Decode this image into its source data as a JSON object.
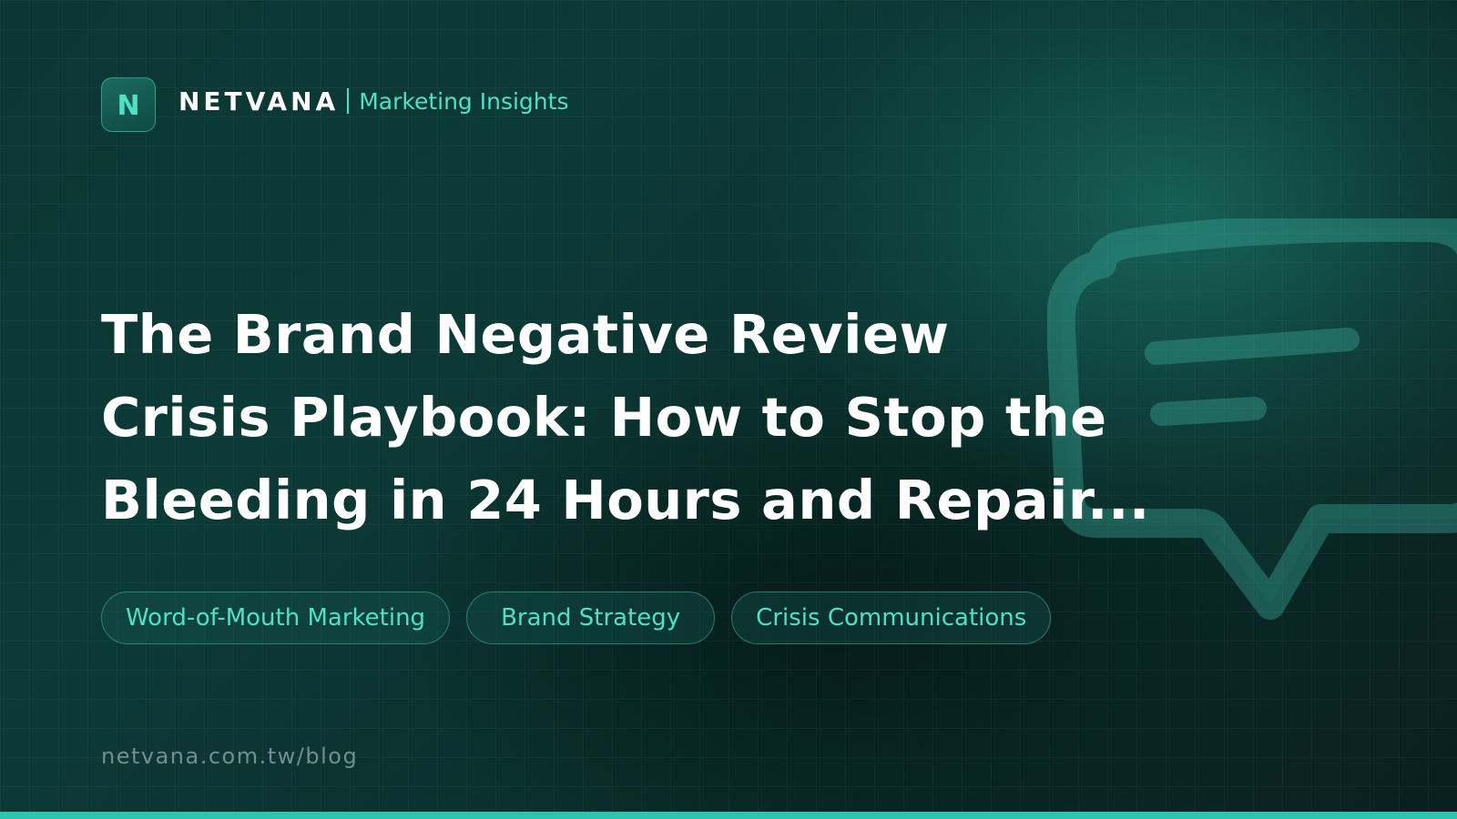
{
  "header": {
    "logo_letter": "N",
    "brand": "NETVANA",
    "section": "Marketing Insights"
  },
  "title": {
    "lines": [
      "The Brand Negative Review",
      "Crisis Playbook: How to Stop the",
      "Bleeding in 24 Hours and Repair..."
    ]
  },
  "tags": [
    "Word-of-Mouth Marketing",
    "Brand Strategy",
    "Crisis Communications"
  ],
  "footer": {
    "url": "netvana.com.tw/blog"
  },
  "colors": {
    "accent": "#4fe0c6",
    "background": "#0c3633",
    "bar": "#2ec5b0"
  },
  "icons": {
    "logo": "netvana-logo-icon",
    "decoration": "speech-bubble-icon"
  }
}
